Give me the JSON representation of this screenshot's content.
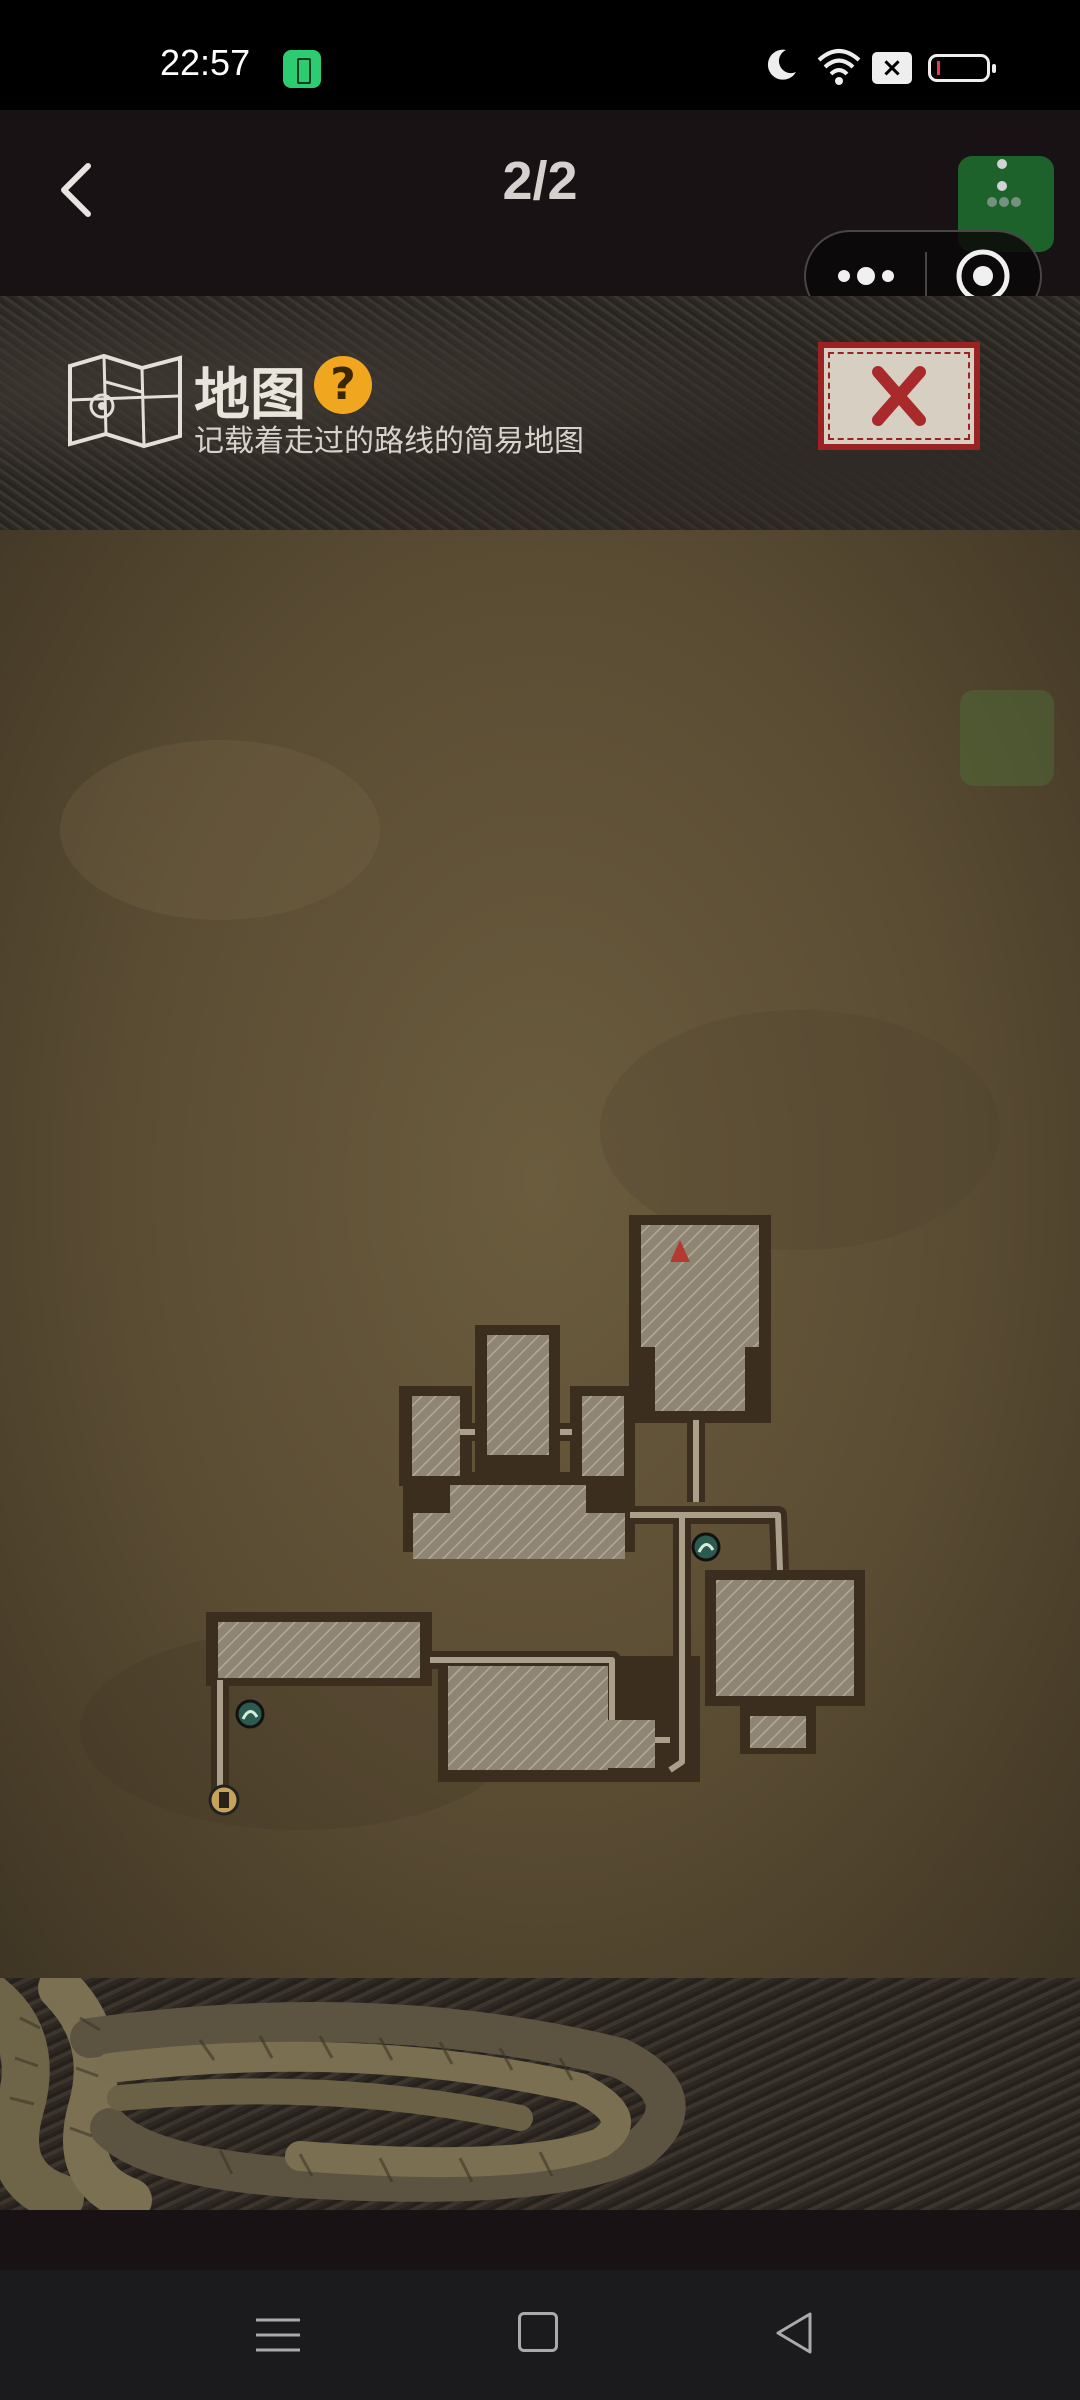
{
  "status_bar": {
    "time": "22:57",
    "icons": [
      "battery-saver-icon",
      "moon-icon",
      "wifi-icon",
      "x-box-icon",
      "battery-icon"
    ]
  },
  "nav": {
    "page_counter": "2/2",
    "back_icon": "chevron-left-icon",
    "capsule_icons": [
      "more-dots-icon",
      "target-close-icon"
    ]
  },
  "header": {
    "title": "地图",
    "help_glyph": "?",
    "subtitle": "记载着走过的路线的简易地图",
    "logo_icon": "map-icon",
    "close_icon": "red-x-icon"
  },
  "map": {
    "markers": [
      "player-arrow-icon",
      "save-point-icon",
      "save-point-icon",
      "exit-door-icon"
    ]
  },
  "system_nav": {
    "icons": [
      "menu-icon",
      "home-icon",
      "back-triangle-icon"
    ]
  },
  "colors": {
    "accent_green": "#2ecc71",
    "help_orange": "#f0a61e",
    "close_red": "#9b2222",
    "parchment": "#5a4c33"
  }
}
